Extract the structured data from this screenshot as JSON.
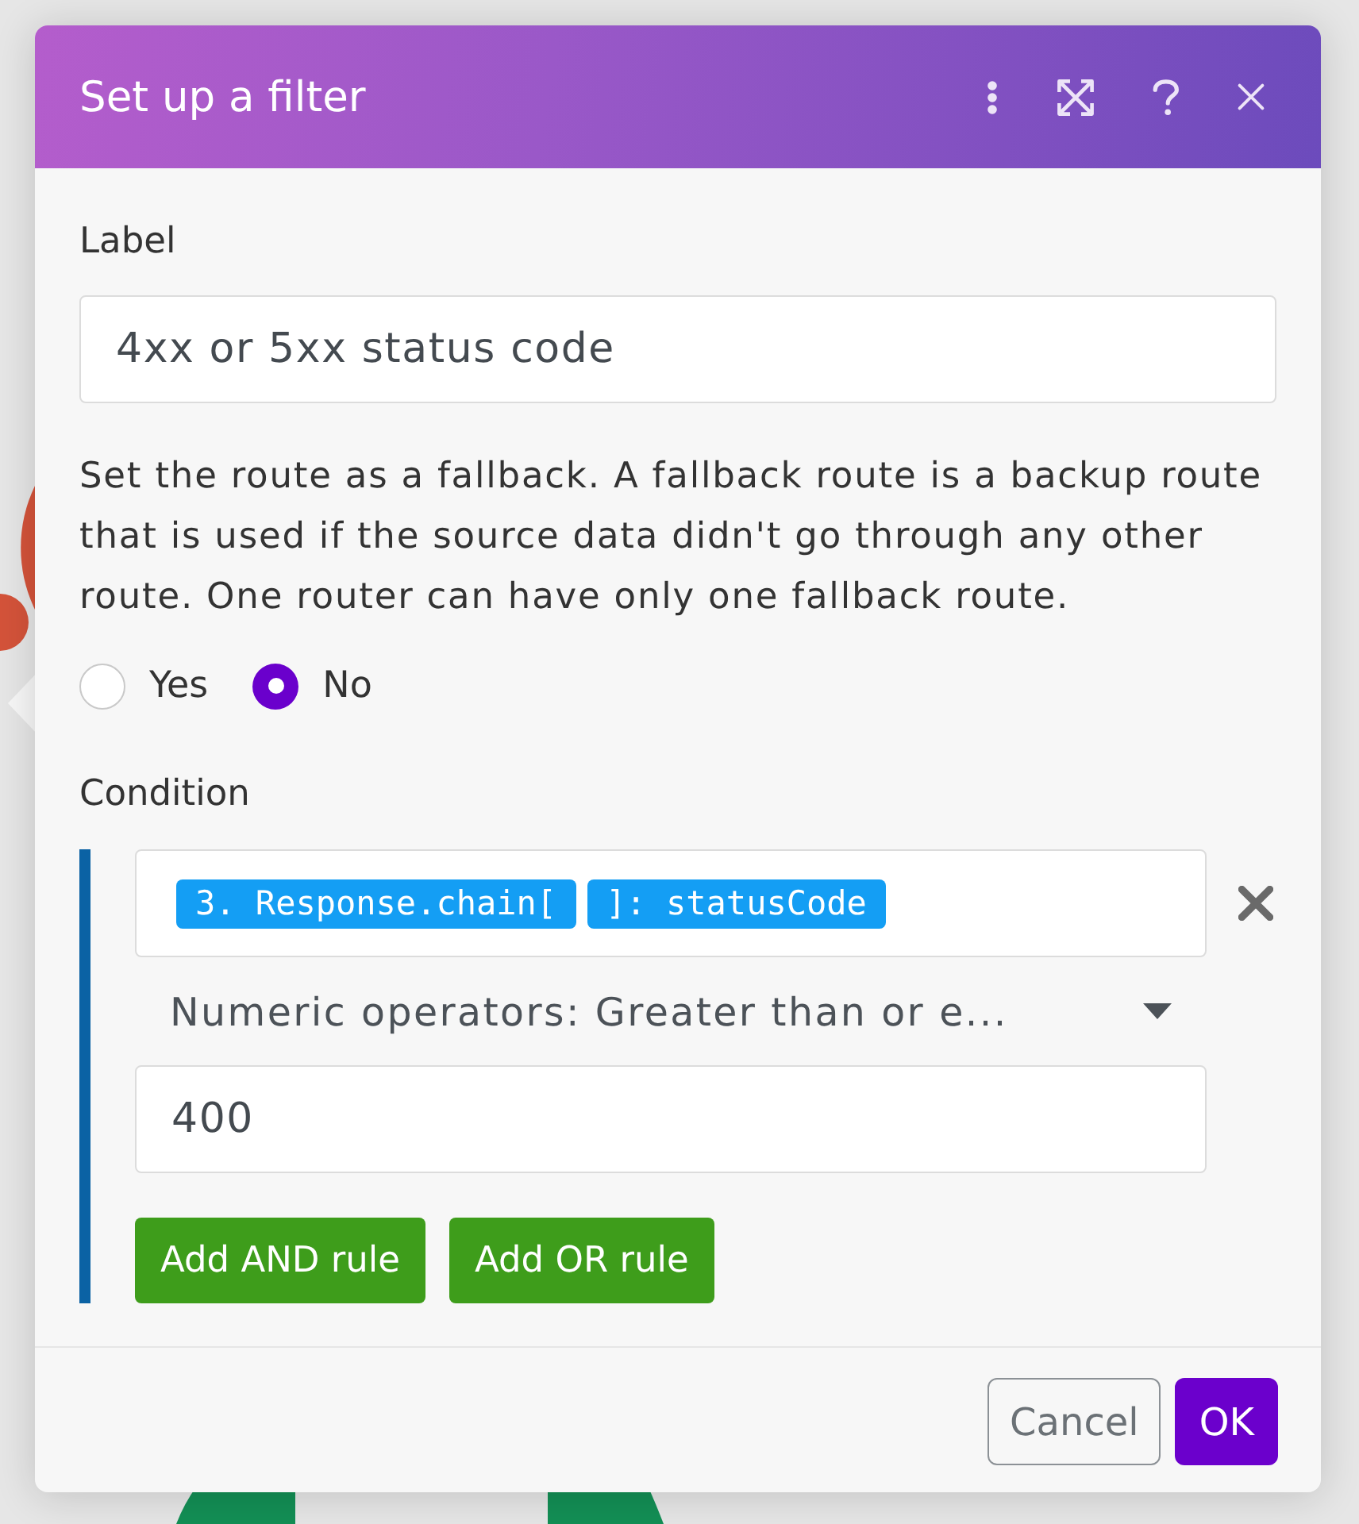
{
  "dialog": {
    "title": "Set up a filter"
  },
  "label_field": {
    "label": "Label",
    "value": "4xx or 5xx status code"
  },
  "fallback": {
    "text": "Set the route as a fallback. A fallback route is a backup route that is used if the source data didn't go through any other route. One router can have only one fallback route.",
    "options": [
      {
        "label": "Yes",
        "selected": false
      },
      {
        "label": "No",
        "selected": true
      }
    ]
  },
  "condition": {
    "label": "Condition",
    "rules": [
      {
        "tags": [
          "3. Response.chain[",
          "]: statusCode"
        ],
        "operator": "Numeric operators: Greater than or e...",
        "value": "400"
      }
    ],
    "buttons": [
      "Add AND rule",
      "Add OR rule"
    ]
  },
  "footer": {
    "buttons": [
      {
        "label": "Cancel",
        "kind": "secondary"
      },
      {
        "label": "OK",
        "kind": "primary"
      }
    ]
  }
}
